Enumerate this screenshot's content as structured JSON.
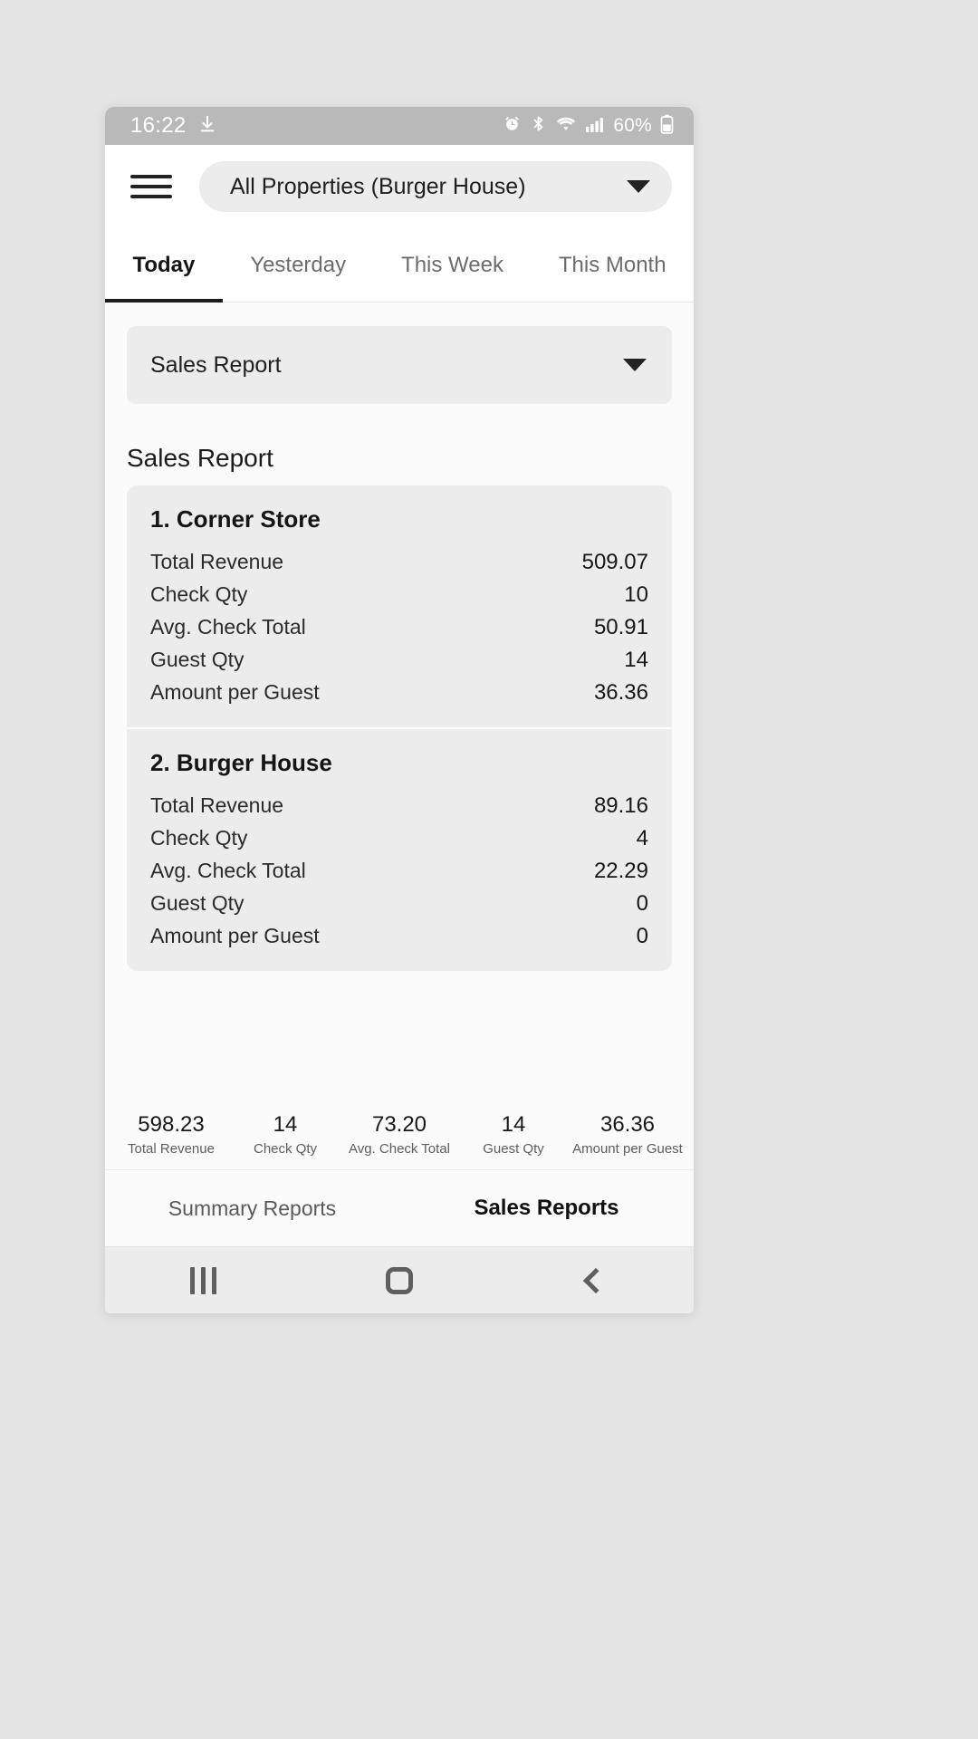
{
  "status_bar": {
    "time": "16:22",
    "download_icon": "download-icon",
    "alarm_icon": "alarm-icon",
    "bluetooth_icon": "bluetooth-icon",
    "wifi_icon": "wifi-icon",
    "signal_icon": "cellular-signal-icon",
    "battery_text": "60%",
    "battery_icon": "battery-icon"
  },
  "header": {
    "menu_icon": "hamburger-menu-icon",
    "property_selector": "All Properties (Burger House)",
    "dropdown_icon": "chevron-down-icon"
  },
  "period_tabs": [
    {
      "label": "Today",
      "active": true
    },
    {
      "label": "Yesterday",
      "active": false
    },
    {
      "label": "This Week",
      "active": false
    },
    {
      "label": "This Month",
      "active": false
    }
  ],
  "report_select": {
    "value": "Sales Report",
    "dropdown_icon": "chevron-down-icon"
  },
  "section_title": "Sales Report",
  "metric_labels": [
    "Total Revenue",
    "Check Qty",
    "Avg. Check Total",
    "Guest Qty",
    "Amount per Guest"
  ],
  "cards": [
    {
      "title": "1. Corner Store",
      "metrics": [
        {
          "label": "Total Revenue",
          "value": "509.07"
        },
        {
          "label": "Check Qty",
          "value": "10"
        },
        {
          "label": "Avg. Check Total",
          "value": "50.91"
        },
        {
          "label": "Guest Qty",
          "value": "14"
        },
        {
          "label": "Amount per Guest",
          "value": "36.36"
        }
      ]
    },
    {
      "title": "2. Burger House",
      "metrics": [
        {
          "label": "Total Revenue",
          "value": "89.16"
        },
        {
          "label": "Check Qty",
          "value": "4"
        },
        {
          "label": "Avg. Check Total",
          "value": "22.29"
        },
        {
          "label": "Guest Qty",
          "value": "0"
        },
        {
          "label": "Amount per Guest",
          "value": "0"
        }
      ]
    }
  ],
  "summary": [
    {
      "value": "598.23",
      "label": "Total Revenue"
    },
    {
      "value": "14",
      "label": "Check Qty"
    },
    {
      "value": "73.20",
      "label": "Avg. Check Total"
    },
    {
      "value": "14",
      "label": "Guest Qty"
    },
    {
      "value": "36.36",
      "label": "Amount per Guest"
    }
  ],
  "bottom_tabs": [
    {
      "label": "Summary Reports",
      "active": false
    },
    {
      "label": "Sales Reports",
      "active": true
    }
  ],
  "nav_bar": {
    "recents_icon": "recents-icon",
    "home_icon": "home-icon",
    "back_icon": "back-icon"
  },
  "colors": {
    "page_background": "#e4e4e4",
    "status_bar": "#b9b9b9",
    "card_background": "#ececec",
    "app_background": "#fbfbfb",
    "accent_underline": "#1c1c1c"
  }
}
